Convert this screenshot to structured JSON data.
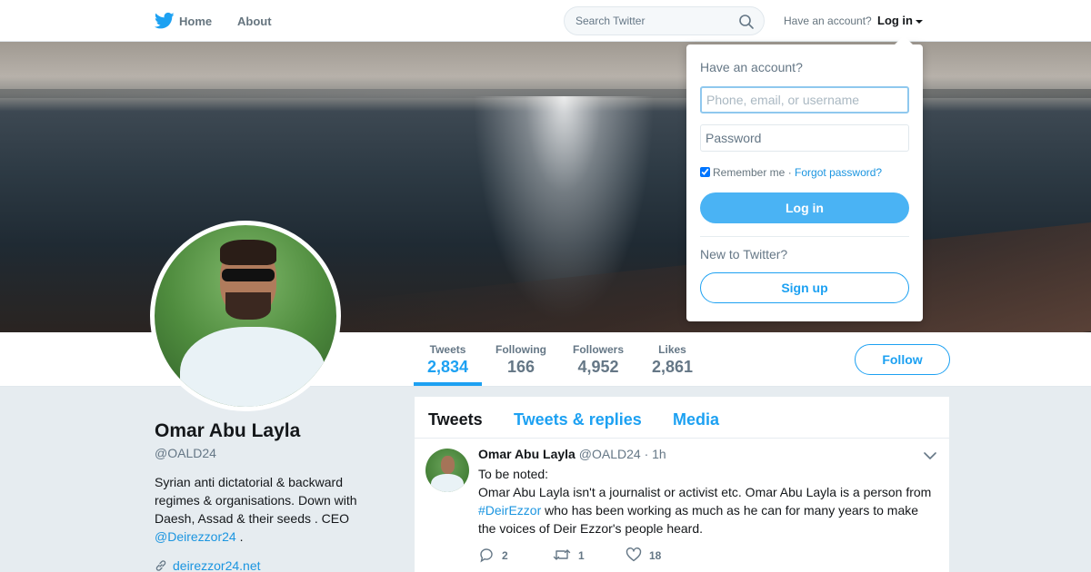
{
  "colors": {
    "accent": "#1da1f2",
    "link": "#1b95e0",
    "muted": "#657786",
    "background": "#e6ecf0"
  },
  "nav": {
    "logo_icon": "twitter-bird-icon",
    "home_label": "Home",
    "about_label": "About",
    "search_placeholder": "Search Twitter",
    "have_account": "Have an account?",
    "login_label": "Log in"
  },
  "login_dropdown": {
    "title": "Have an account?",
    "username_placeholder": "Phone, email, or username",
    "password_placeholder": "Password",
    "remember_me": "Remember me",
    "separator": "·",
    "forgot_password": "Forgot password?",
    "login_button": "Log in",
    "new_prompt": "New to Twitter?",
    "signup_button": "Sign up"
  },
  "profile": {
    "name": "Omar Abu Layla",
    "handle": "@OALD24",
    "bio_text": "Syrian anti dictatorial & backward regimes & organisations. Down with Daesh, Assad & their seeds . CEO",
    "bio_link": "@Deirezzor24",
    "bio_suffix": " .",
    "url": "deirezzor24.net",
    "follow_button": "Follow",
    "stats": [
      {
        "label": "Tweets",
        "value": "2,834"
      },
      {
        "label": "Following",
        "value": "166"
      },
      {
        "label": "Followers",
        "value": "4,952"
      },
      {
        "label": "Likes",
        "value": "2,861"
      }
    ]
  },
  "timeline": {
    "tabs": [
      "Tweets",
      "Tweets & replies",
      "Media"
    ],
    "tweet": {
      "author": "Omar Abu Layla",
      "handle": "@OALD24",
      "dot": "·",
      "time": "1h",
      "line1": "To be noted:",
      "text_before": "Omar Abu Layla isn't a journalist or activist etc. Omar Abu Layla is a person from ",
      "hashtag": "#DeirEzzor",
      "text_after": " who has been working as much as he can for many years to make the voices of Deir Ezzor's people heard.",
      "replies": "2",
      "retweets": "1",
      "likes": "18"
    }
  }
}
